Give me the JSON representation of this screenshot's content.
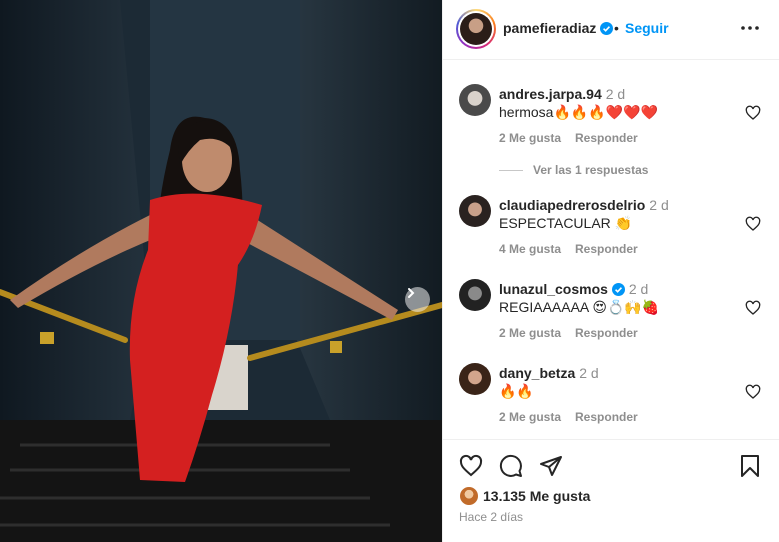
{
  "post": {
    "author": "pamefieradiaz",
    "follow_label": "Seguir",
    "separator": "•",
    "more_icon": "more-horizontal-icon",
    "photo_description_icon": "photo"
  },
  "comments": [
    {
      "user": "andres.jarpa.94",
      "time": "2 d",
      "text": "hermosa🔥🔥🔥❤️❤️❤️",
      "likes": "2 Me gusta",
      "reply": "Responder",
      "verified": false
    },
    {
      "user": "claudiapedrerosdelrio",
      "time": "2 d",
      "text": "ESPECTACULAR 👏",
      "likes": "4 Me gusta",
      "reply": "Responder",
      "verified": false
    },
    {
      "user": "lunazul_cosmos",
      "time": "2 d",
      "text": "REGIAAAAAA 😍💍🙌🍓",
      "likes": "2 Me gusta",
      "reply": "Responder",
      "verified": true
    },
    {
      "user": "dany_betza",
      "time": "2 d",
      "text": "🔥🔥",
      "likes": "2 Me gusta",
      "reply": "Responder",
      "verified": false
    }
  ],
  "view_replies": "Ver las 1 respuestas",
  "actions": {
    "like_count": "13.135 Me gusta",
    "time_ago": "Hace 2 días"
  },
  "colors": {
    "accent": "#0095f6",
    "muted": "#8e8e8e",
    "dress": "#d42020"
  }
}
